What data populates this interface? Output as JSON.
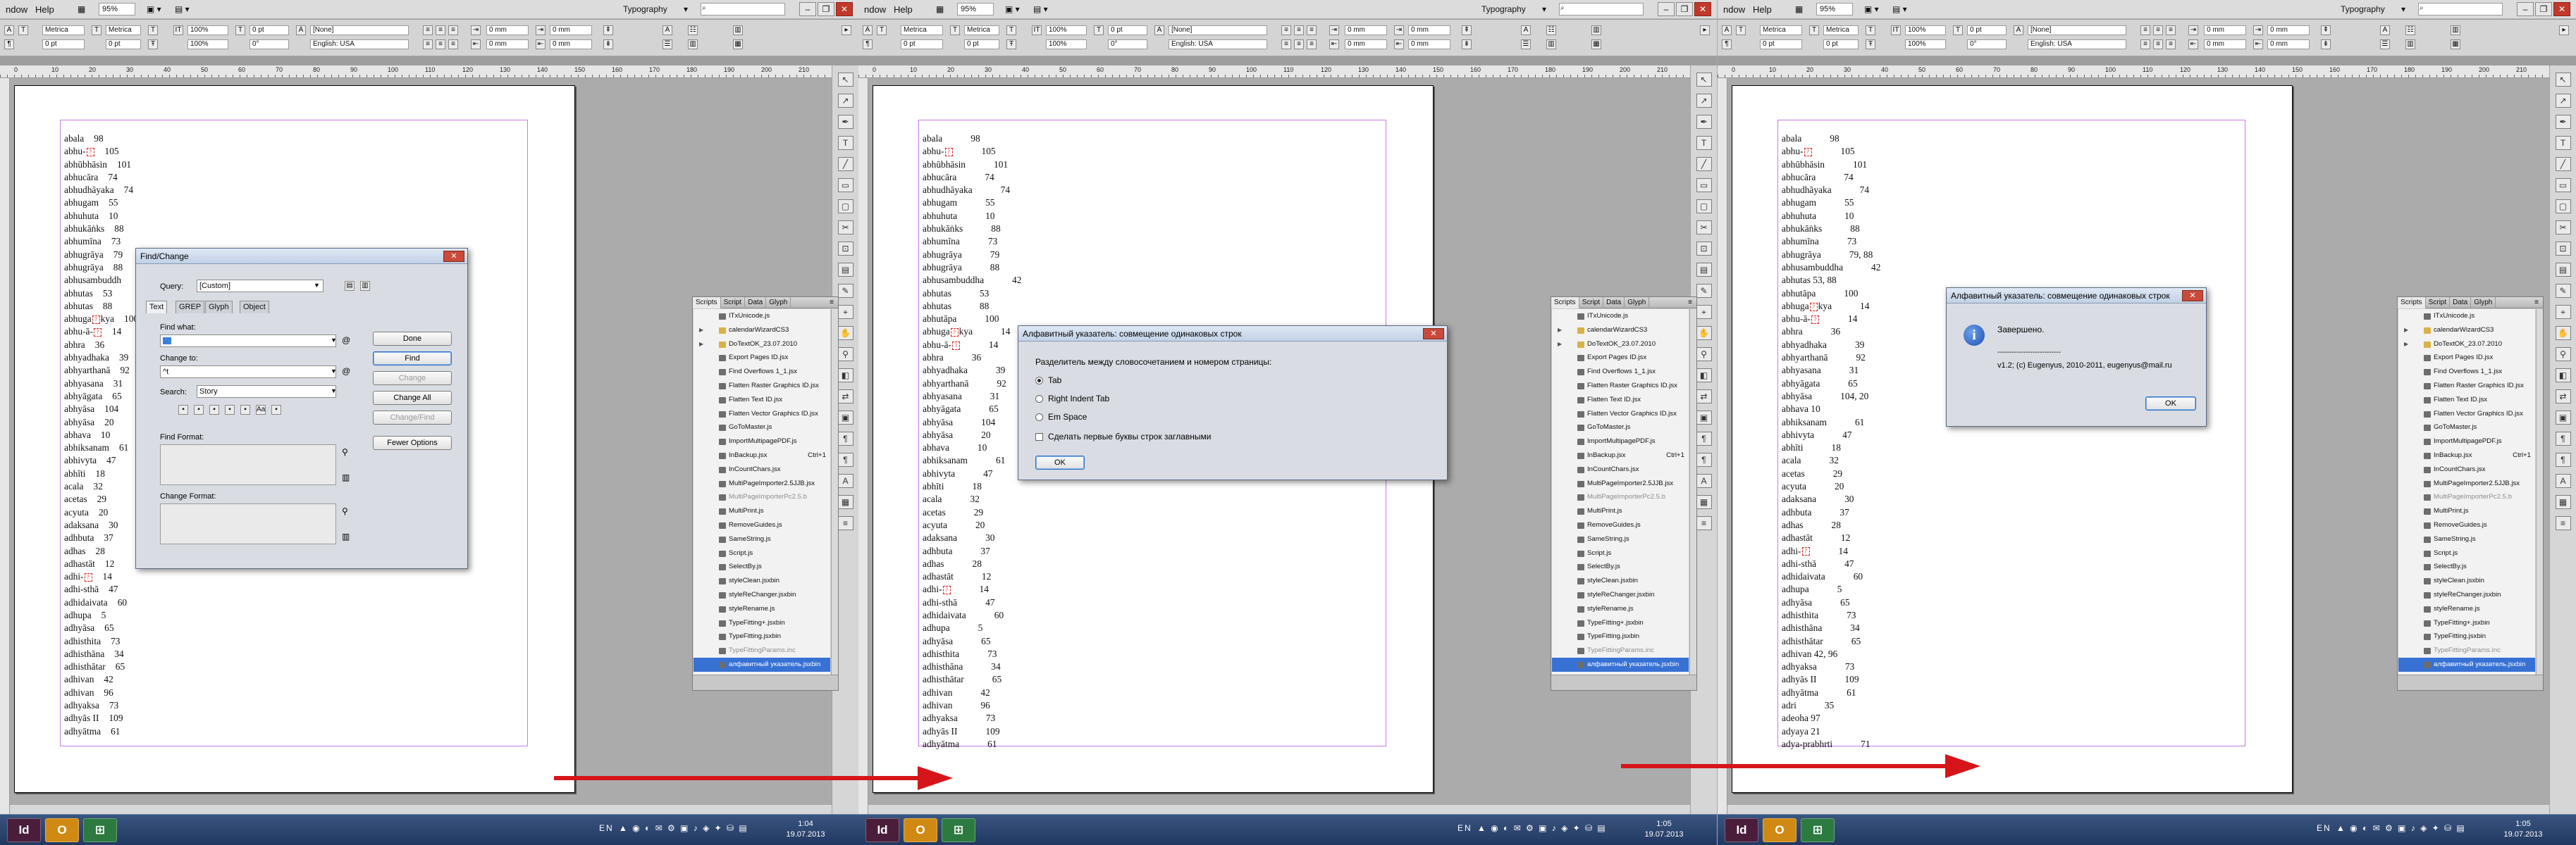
{
  "app": {
    "menu": [
      "ndow",
      "Help"
    ],
    "zoom": "95%",
    "workspace": "Typography",
    "search_placeholder": ""
  },
  "control_bar": {
    "font_style_1": "Metrica",
    "font_size_1": "0 pt",
    "font_style_2": "Metrica",
    "font_size_2": "0 pt",
    "scale_h": "100%",
    "scale_v": "100%",
    "kerning": "0 pt",
    "skew": "0°",
    "char_style": "[None]",
    "language": "English: USA",
    "indent_1": "0 mm",
    "indent_2": "0 mm",
    "indent_3": "0 mm",
    "indent_4": "0 mm"
  },
  "ruler_ticks": [
    "0",
    "10",
    "20",
    "30",
    "40",
    "50",
    "60",
    "70",
    "80",
    "90",
    "100",
    "110",
    "120",
    "130",
    "140",
    "150",
    "160",
    "170",
    "180",
    "190",
    "200",
    "210"
  ],
  "document_panels": [
    {
      "lines": [
        {
          "w": "abala",
          "p": "98"
        },
        {
          "w": "abhu-",
          "mark": true,
          "p": "105"
        },
        {
          "w": "abhūbhāsin",
          "p": "101"
        },
        {
          "w": "abhucāra",
          "p": "74"
        },
        {
          "w": "abhudhāyaka",
          "p": "74"
        },
        {
          "w": "abhugam",
          "p": "55"
        },
        {
          "w": "abhuhuta",
          "p": "10"
        },
        {
          "w": "abhukāṅks",
          "p": "88"
        },
        {
          "w": "abhumīna",
          "p": "73"
        },
        {
          "w": "abhugrāya",
          "p": "79"
        },
        {
          "w": "abhugrāya",
          "p": "88"
        },
        {
          "w": "abhusambuddh",
          "p": ""
        },
        {
          "w": "abhutas",
          "p": "53"
        },
        {
          "w": "abhutas",
          "p": "88"
        },
        {
          "w": "abhuga",
          "mark": true,
          "w2": "kya",
          "p": "100"
        },
        {
          "w": "abhu-ā-",
          "mark": true,
          "p": "14"
        },
        {
          "w": "abhra",
          "p": "36"
        },
        {
          "w": "abhyadhaka",
          "p": "39"
        },
        {
          "w": "abhyarthanā",
          "p": "92"
        },
        {
          "w": "abhyasana",
          "p": "31"
        },
        {
          "w": "abhyāgata",
          "p": "65"
        },
        {
          "w": "abhyāsa",
          "p": "104"
        },
        {
          "w": "abhyāsa",
          "p": "20"
        },
        {
          "w": "abhava",
          "p": "10"
        },
        {
          "w": "abhiksanam",
          "p": "61"
        },
        {
          "w": "abhivyta",
          "p": "47"
        },
        {
          "w": "abhīti",
          "p": "18"
        },
        {
          "w": "acala",
          "p": "32"
        },
        {
          "w": "acetas",
          "p": "29"
        },
        {
          "w": "acyuta",
          "p": "20"
        },
        {
          "w": "adaksana",
          "p": "30"
        },
        {
          "w": "adhbuta",
          "p": "37"
        },
        {
          "w": "adhas",
          "p": "28"
        },
        {
          "w": "adhastāt",
          "p": "12"
        },
        {
          "w": "adhi-",
          "mark": true,
          "p": "14"
        },
        {
          "w": "adhi-sthā",
          "p": "47"
        },
        {
          "w": "adhidaivata",
          "p": "60"
        },
        {
          "w": "adhupa",
          "p": "5"
        },
        {
          "w": "adhyāsa",
          "p": "65"
        },
        {
          "w": "adhisthita",
          "p": "73"
        },
        {
          "w": "adhisthāna",
          "p": "34"
        },
        {
          "w": "adhisthātar",
          "p": "65"
        },
        {
          "w": "adhivan",
          "p": "42"
        },
        {
          "w": "adhivan",
          "p": "96"
        },
        {
          "w": "adhyaksa",
          "p": "73"
        },
        {
          "w": "adhyās II",
          "p": "109"
        },
        {
          "w": "adhyātma",
          "p": "61"
        }
      ]
    },
    {
      "lines": [
        {
          "w": "abala",
          "p": "98"
        },
        {
          "w": "abhu-",
          "mark": true,
          "p": "105"
        },
        {
          "w": "abhūbhāsin",
          "p": "101"
        },
        {
          "w": "abhucāra",
          "p": "74"
        },
        {
          "w": "abhudhāyaka",
          "p": "74"
        },
        {
          "w": "abhugam",
          "p": "55"
        },
        {
          "w": "abhuhuta",
          "p": "10"
        },
        {
          "w": "abhukāṅks",
          "p": "88"
        },
        {
          "w": "abhumīna",
          "p": "73"
        },
        {
          "w": "abhugrāya",
          "p": "79"
        },
        {
          "w": "abhugrāya",
          "p": "88"
        },
        {
          "w": "abhusambuddha",
          "p": "42"
        },
        {
          "w": "abhutas",
          "p": "53"
        },
        {
          "w": "abhutas",
          "p": "88"
        },
        {
          "w": "abhutāpa",
          "p": "100"
        },
        {
          "w": "abhuga",
          "mark": true,
          "w2": "kya",
          "p": "14"
        },
        {
          "w": "abhu-ā-",
          "mark": true,
          "p": "14"
        },
        {
          "w": "abhra",
          "p": "36"
        },
        {
          "w": "abhyadhaka",
          "p": "39"
        },
        {
          "w": "abhyarthanā",
          "p": "92"
        },
        {
          "w": "abhyasana",
          "p": "31"
        },
        {
          "w": "abhyāgata",
          "p": "65"
        },
        {
          "w": "abhyāsa",
          "p": "104"
        },
        {
          "w": "abhyāsa",
          "p": "20"
        },
        {
          "w": "abhava",
          "p": "10"
        },
        {
          "w": "abhiksanam",
          "p": "61"
        },
        {
          "w": "abhivyta",
          "p": "47"
        },
        {
          "w": "abhīti",
          "p": "18"
        },
        {
          "w": "acala",
          "p": "32"
        },
        {
          "w": "acetas",
          "p": "29"
        },
        {
          "w": "acyuta",
          "p": "20"
        },
        {
          "w": "adaksana",
          "p": "30"
        },
        {
          "w": "adhbuta",
          "p": "37"
        },
        {
          "w": "adhas",
          "p": "28"
        },
        {
          "w": "adhastāt",
          "p": "12"
        },
        {
          "w": "adhi-",
          "mark": true,
          "p": "14"
        },
        {
          "w": "adhi-sthā",
          "p": "47"
        },
        {
          "w": "adhidaivata",
          "p": "60"
        },
        {
          "w": "adhupa",
          "p": "5"
        },
        {
          "w": "adhyāsa",
          "p": "65"
        },
        {
          "w": "adhisthita",
          "p": "73"
        },
        {
          "w": "adhisthāna",
          "p": "34"
        },
        {
          "w": "adhisthātar",
          "p": "65"
        },
        {
          "w": "adhivan",
          "p": "42"
        },
        {
          "w": "adhivan",
          "p": "96"
        },
        {
          "w": "adhyaksa",
          "p": "73"
        },
        {
          "w": "adhyās II",
          "p": "109"
        },
        {
          "w": "adhyātma",
          "p": "61"
        }
      ]
    },
    {
      "lines": [
        {
          "w": "abala",
          "p": "98"
        },
        {
          "w": "abhu-",
          "mark": true,
          "p": "105"
        },
        {
          "w": "abhūbhāsin",
          "p": "101"
        },
        {
          "w": "abhucāra",
          "p": "74"
        },
        {
          "w": "abhudhāyaka",
          "p": "74"
        },
        {
          "w": "abhugam",
          "p": "55"
        },
        {
          "w": "abhuhuta",
          "p": "10"
        },
        {
          "w": "abhukāṅks",
          "p": "88"
        },
        {
          "w": "abhumīna",
          "p": "73"
        },
        {
          "w": "abhugrāya",
          "p": "79, 88"
        },
        {
          "w": "abhusambuddha",
          "p": "42"
        },
        {
          "w": "abhutas 53, 88",
          "p": ""
        },
        {
          "w": "abhutāpa",
          "p": "100"
        },
        {
          "w": "abhuga",
          "mark": true,
          "w2": "kya",
          "p": "14"
        },
        {
          "w": "abhu-ā-",
          "mark": true,
          "p": "14"
        },
        {
          "w": "abhra",
          "p": "36"
        },
        {
          "w": "abhyadhaka",
          "p": "39"
        },
        {
          "w": "abhyarthanā",
          "p": "92"
        },
        {
          "w": "abhyasana",
          "p": "31"
        },
        {
          "w": "abhyāgata",
          "p": "65"
        },
        {
          "w": "abhyāsa",
          "p": "104, 20"
        },
        {
          "w": "abhava 10",
          "p": ""
        },
        {
          "w": "abhiksanam",
          "p": "61"
        },
        {
          "w": "abhivyta",
          "p": "47"
        },
        {
          "w": "abhīti",
          "p": "18"
        },
        {
          "w": "acala",
          "p": "32"
        },
        {
          "w": "acetas",
          "p": "29"
        },
        {
          "w": "acyuta",
          "p": "20"
        },
        {
          "w": "adaksana",
          "p": "30"
        },
        {
          "w": "adhbuta",
          "p": "37"
        },
        {
          "w": "adhas",
          "p": "28"
        },
        {
          "w": "adhastāt",
          "p": "12"
        },
        {
          "w": "adhi-",
          "mark": true,
          "p": "14"
        },
        {
          "w": "adhi-sthā",
          "p": "47"
        },
        {
          "w": "adhidaivata",
          "p": "60"
        },
        {
          "w": "adhupa",
          "p": "5"
        },
        {
          "w": "adhyāsa",
          "p": "65"
        },
        {
          "w": "adhisthita",
          "p": "73"
        },
        {
          "w": "adhisthāna",
          "p": "34"
        },
        {
          "w": "adhisthātar",
          "p": "65"
        },
        {
          "w": "adhivan 42, 96",
          "p": ""
        },
        {
          "w": "adhyaksa",
          "p": "73"
        },
        {
          "w": "adhyās II",
          "p": "109"
        },
        {
          "w": "adhyātma",
          "p": "61"
        },
        {
          "w": "adri",
          "p": "35"
        },
        {
          "w": "adeoha 97",
          "p": ""
        },
        {
          "w": "adyaya 21",
          "p": ""
        },
        {
          "w": "adya-prabhrti",
          "p": "71"
        }
      ]
    }
  ],
  "find_change": {
    "title": "Find/Change",
    "query_label": "Query:",
    "query_value": "[Custom]",
    "tabs": [
      "Text",
      "GREP",
      "Glyph",
      "Object"
    ],
    "find_what_label": "Find what:",
    "change_to_label": "Change to:",
    "change_to_value": "^t",
    "search_label": "Search:",
    "search_value": "Story",
    "find_format_label": "Find Format:",
    "change_format_label": "Change Format:",
    "buttons": {
      "done": "Done",
      "find": "Find",
      "change": "Change",
      "change_all": "Change All",
      "change_find": "Change/Find",
      "fewer_options": "Fewer Options"
    }
  },
  "scripts_panel": {
    "tabs": [
      "Scripts",
      "Script",
      "Data",
      "Glyph"
    ],
    "items": [
      {
        "name": "ITxUnicode.js",
        "fold": false
      },
      {
        "name": "calendarWizardCS3",
        "fold": true,
        "twisty": true
      },
      {
        "name": "DoTextOK_23.07.2010",
        "fold": true,
        "twisty": true
      },
      {
        "name": "Export Pages ID.jsx",
        "fold": false
      },
      {
        "name": "Find Overflows 1_1.jsx",
        "fold": false
      },
      {
        "name": "Flatten Raster Graphics ID.jsx",
        "fold": false
      },
      {
        "name": "Flatten Text ID.jsx",
        "fold": false
      },
      {
        "name": "Flatten Vector Graphics ID.jsx",
        "fold": false
      },
      {
        "name": "GoToMaster.js",
        "fold": false
      },
      {
        "name": "ImportMultipagePDF.js",
        "fold": false
      },
      {
        "name": "InBackup.jsx",
        "fold": false,
        "shortcut": "Ctrl+1"
      },
      {
        "name": "InCountChars.jsx",
        "fold": false
      },
      {
        "name": "MultiPageImporter2.5JJB.jsx",
        "fold": false
      },
      {
        "name": "MultiPageImporterPc2.5.b",
        "fold": false,
        "grey": true
      },
      {
        "name": "MultiPrint.js",
        "fold": false
      },
      {
        "name": "RemoveGuides.js",
        "fold": false
      },
      {
        "name": "SameString.js",
        "fold": false
      },
      {
        "name": "Script.js",
        "fold": false
      },
      {
        "name": "SelectBy.js",
        "fold": false
      },
      {
        "name": "styleClean.jsxbin",
        "fold": false
      },
      {
        "name": "styleReChanger.jsxbin",
        "fold": false
      },
      {
        "name": "styleRename.js",
        "fold": false
      },
      {
        "name": "TypeFitting+.jsxbin",
        "fold": false
      },
      {
        "name": "TypeFitting.jsxbin",
        "fold": false
      },
      {
        "name": "TypeFittingParams.inc",
        "fold": false,
        "grey": true
      },
      {
        "name": "алфавитный указатель.jsxbin",
        "fold": false,
        "selected": true
      }
    ]
  },
  "align_dialog": {
    "title": "Алфавитный указатель: совмещение одинаковых строк",
    "prompt": "Разделитель между словосочетанием и номером страницы:",
    "options": [
      {
        "label": "Tab",
        "checked": true
      },
      {
        "label": "Right Indent Tab",
        "checked": false
      },
      {
        "label": "Em Space",
        "checked": false
      }
    ],
    "checkbox_label": "Сделать первые буквы строк заглавными",
    "ok": "OK"
  },
  "done_dialog": {
    "title": "Алфавитный указатель: совмещение одинаковых строк",
    "message": "Завершено.",
    "separator": "---------------------------",
    "credit": "v1.2; (c) Eugenyus, 2010-2011, eugenyus@mail.ru",
    "ok": "OK"
  },
  "taskbars": [
    {
      "time": "1:04",
      "date": "19.07.2013",
      "lang": "EN"
    },
    {
      "time": "1:05",
      "date": "19.07.2013",
      "lang": "EN"
    },
    {
      "time": "1:05",
      "date": "19.07.2013",
      "lang": "EN"
    }
  ],
  "colors": {
    "arrow": "#d6151b",
    "selection": "#3771d3",
    "margin_frame": "#c77ce0"
  }
}
